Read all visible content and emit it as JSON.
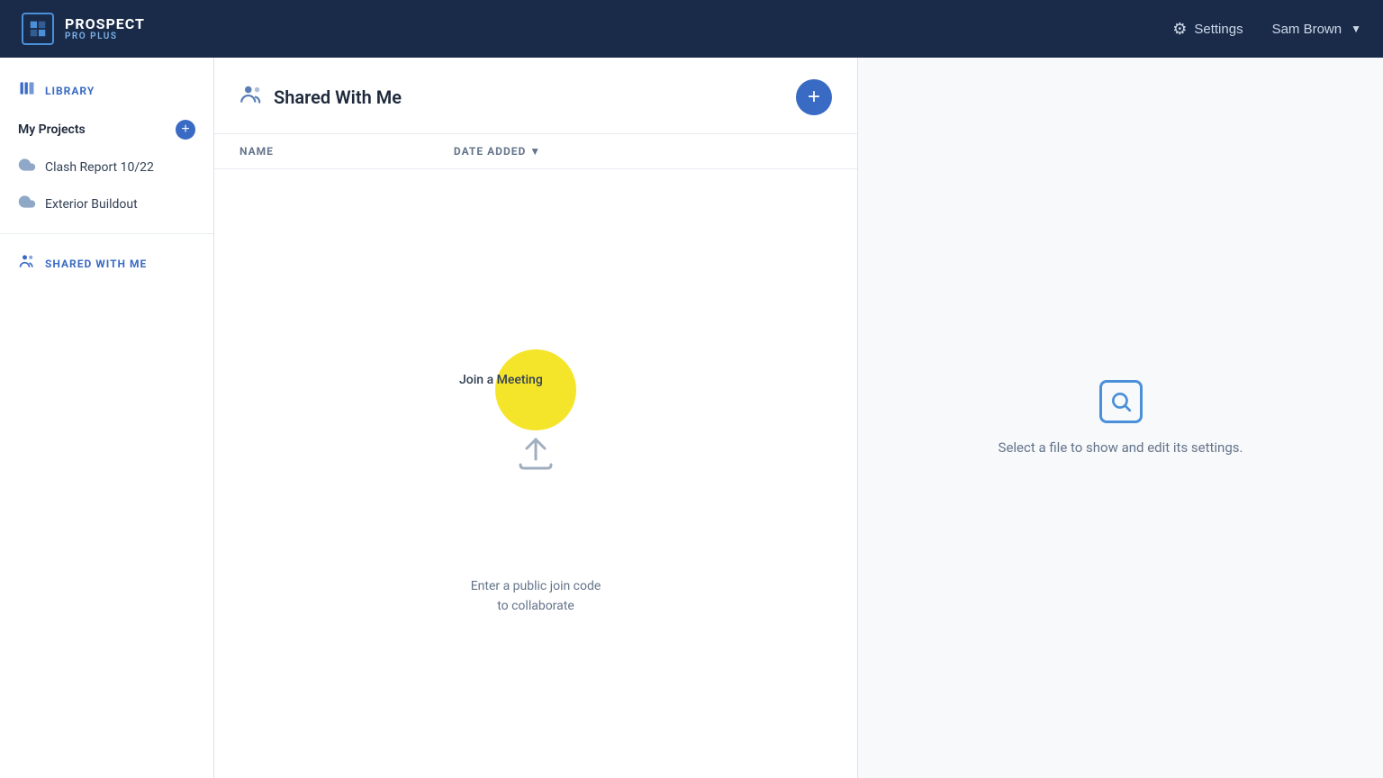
{
  "topnav": {
    "brand": {
      "prospect": "PROSPECT",
      "proplus": "PRO PLUS"
    },
    "settings_label": "Settings",
    "user_name": "Sam Brown"
  },
  "sidebar": {
    "library_label": "LIBRARY",
    "my_projects_label": "My Projects",
    "projects": [
      {
        "name": "Clash Report 10/22"
      },
      {
        "name": "Exterior Buildout"
      }
    ],
    "shared_with_me_label": "SHARED WITH ME"
  },
  "file_panel": {
    "title": "Shared With Me",
    "col_name": "NAME",
    "col_date_added": "DATE ADDED",
    "empty_line1": "Enter a public join code",
    "empty_line2": "to collaborate",
    "join_meeting_label": "Join a Meeting"
  },
  "right_panel": {
    "hint_text": "Select a file to show and edit its settings."
  }
}
